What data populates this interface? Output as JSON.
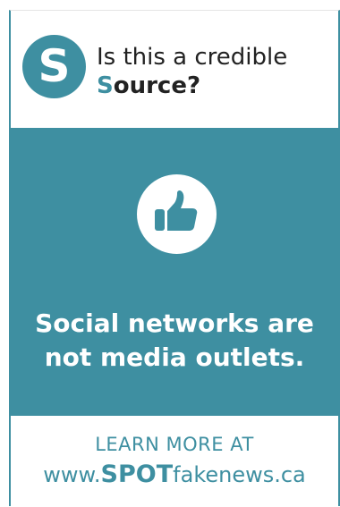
{
  "header": {
    "logo_letter": "S",
    "line1": "Is this a credible",
    "line2_accent": "S",
    "line2_rest": "ource?"
  },
  "main": {
    "icon": "thumbs-up-icon",
    "message_line1": "Social networks are",
    "message_line2": "not media outlets."
  },
  "footer": {
    "learn_more": "LEARN MORE AT",
    "url_prefix": "www.",
    "url_bold": "SPOT",
    "url_suffix": "fakenews.ca"
  },
  "colors": {
    "brand_teal": "#3e8fa1",
    "text_dark": "#222222",
    "background": "#ffffff"
  }
}
